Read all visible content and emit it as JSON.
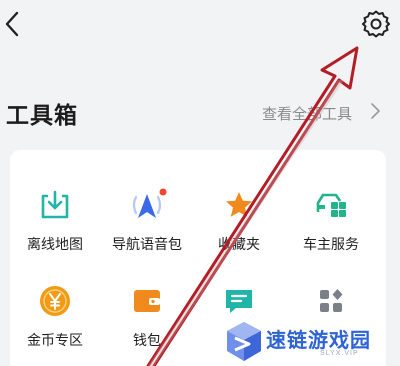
{
  "header": {
    "back_icon": "chevron-left-icon",
    "settings_icon": "gear-icon"
  },
  "toolbox": {
    "title": "工具箱",
    "view_all": "查看全部工具",
    "view_all_icon": "chevron-right-icon",
    "items": [
      {
        "label": "离线地图",
        "icon": "download-box-icon",
        "color": "#1fb5a8"
      },
      {
        "label": "导航语音包",
        "icon": "navigation-arrow-icon",
        "color": "#3a6ae8",
        "badge": true
      },
      {
        "label": "收藏夹",
        "icon": "star-icon",
        "color": "#f08a1c"
      },
      {
        "label": "车主服务",
        "icon": "car-service-icon",
        "color": "#23b58a"
      },
      {
        "label": "金币专区",
        "icon": "yen-coin-icon",
        "color": "#f29a16"
      },
      {
        "label": "钱包",
        "icon": "wallet-icon",
        "color": "#f08a1c"
      },
      {
        "label": "",
        "icon": "chat-message-icon",
        "color": "#1fb5a8"
      },
      {
        "label": "",
        "icon": "more-grid-icon",
        "color": "#7a7f8a"
      }
    ]
  },
  "annotation": {
    "arrow_color": "#b31d26"
  },
  "watermark": {
    "text": "速链游戏园",
    "url": "SLYX.VIP",
    "logo_icon": "cube-logo-icon",
    "color": "#2e63d6"
  }
}
